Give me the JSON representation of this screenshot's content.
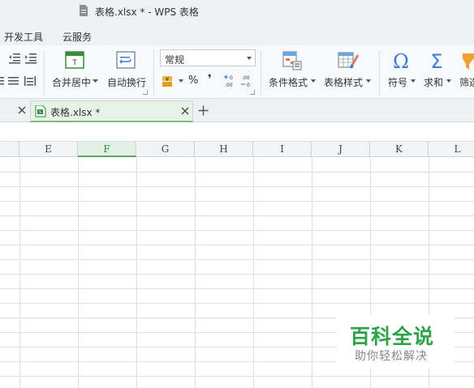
{
  "window": {
    "title": "表格.xlsx * - WPS 表格"
  },
  "menu_tabs": [
    "开发工具",
    "云服务"
  ],
  "ribbon": {
    "merge_center": "合并居中",
    "wrap_text": "自动换行",
    "number_format": "常规",
    "percent_symbol": "%",
    "comma_symbol": "❜",
    "increase_decimal": ".00",
    "decrease_decimal": ".00",
    "conditional_format": "条件格式",
    "table_style": "表格样式",
    "symbol": "符号",
    "sum": "求和",
    "filter": "筛选"
  },
  "doc_tab": {
    "label": "表格.xlsx *"
  },
  "columns": [
    {
      "label": "E",
      "active": false
    },
    {
      "label": "F",
      "active": true
    },
    {
      "label": "G",
      "active": false
    },
    {
      "label": "H",
      "active": false
    },
    {
      "label": "I",
      "active": false
    },
    {
      "label": "J",
      "active": false
    },
    {
      "label": "K",
      "active": false
    },
    {
      "label": "L",
      "active": false
    }
  ],
  "watermark": {
    "title": "百科全说",
    "subtitle": "助你轻松解决"
  },
  "colors": {
    "accent_green": "#2ea34a",
    "active_col_bg": "#e2efe2",
    "grid_line": "#dcdfe3"
  }
}
